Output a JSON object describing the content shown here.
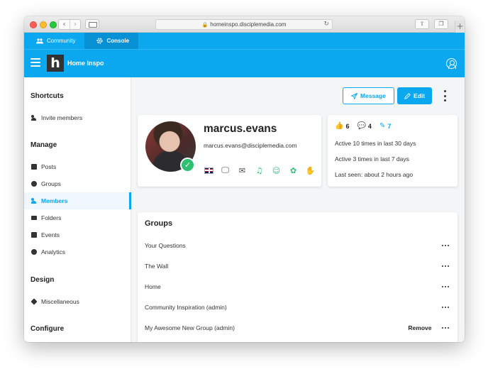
{
  "browser": {
    "url": "homeinspo.disciplemedia.com"
  },
  "tabs": [
    {
      "label": "Community",
      "icon": "community-icon"
    },
    {
      "label": "Console",
      "icon": "gear-icon"
    }
  ],
  "header": {
    "brand": "Home Inspo",
    "logo_letter": "h"
  },
  "sidebar": {
    "shortcuts_title": "Shortcuts",
    "invite_label": "Invite members",
    "manage_title": "Manage",
    "manage_items": [
      {
        "label": "Posts"
      },
      {
        "label": "Groups"
      },
      {
        "label": "Members"
      },
      {
        "label": "Folders"
      },
      {
        "label": "Events"
      },
      {
        "label": "Analytics"
      }
    ],
    "design_title": "Design",
    "misc_label": "Miscellaneous",
    "configure_title": "Configure"
  },
  "actions": {
    "message_label": "Message",
    "edit_label": "Edit"
  },
  "profile": {
    "username": "marcus.evans",
    "email": "marcus.evans@disciplemedia.com"
  },
  "stats": {
    "likes": "6",
    "comments": "4",
    "posts": "7",
    "active_30": "Active 10 times in last 30 days",
    "active_7": "Active 3 times in last 7 days",
    "last_seen": "Last seen: about 2 hours ago"
  },
  "groups": {
    "title": "Groups",
    "remove_label": "Remove",
    "items": [
      {
        "name": "Your Questions"
      },
      {
        "name": "The Wall"
      },
      {
        "name": "Home"
      },
      {
        "name": "Community Inspiration (admin)"
      },
      {
        "name": "My Awesome New Group (admin)"
      }
    ]
  },
  "colors": {
    "accent": "#0ba7ef",
    "success": "#2fbf71"
  }
}
